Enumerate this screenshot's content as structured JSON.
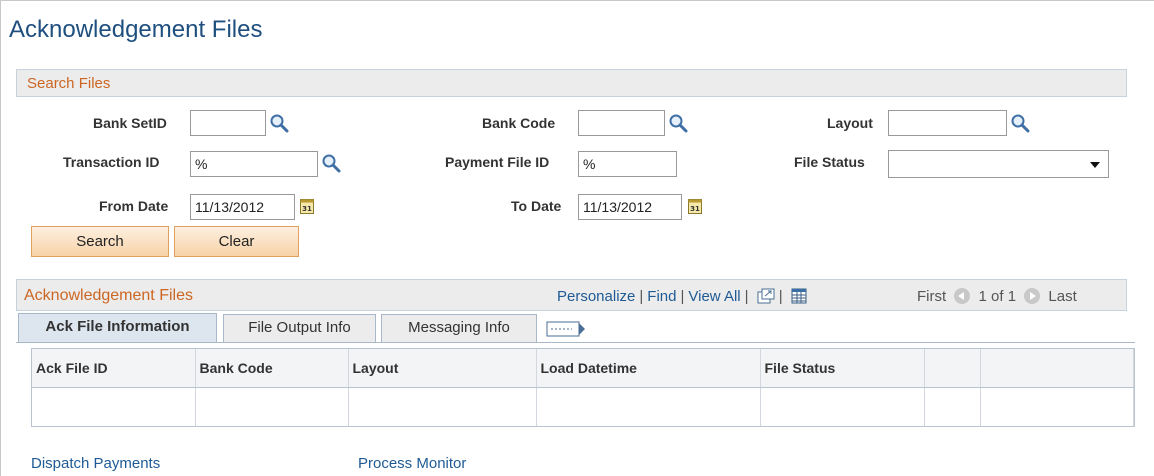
{
  "page": {
    "title": "Acknowledgement Files"
  },
  "search_files": {
    "title": "Search Files",
    "bank_setid": {
      "label": "Bank SetID",
      "value": ""
    },
    "bank_code": {
      "label": "Bank Code",
      "value": ""
    },
    "layout": {
      "label": "Layout",
      "value": ""
    },
    "transaction_id": {
      "label": "Transaction ID",
      "value": "%"
    },
    "payment_file_id": {
      "label": "Payment File ID",
      "value": "%"
    },
    "file_status": {
      "label": "File Status",
      "value": ""
    },
    "from_date": {
      "label": "From Date",
      "value": "11/13/2012"
    },
    "to_date": {
      "label": "To Date",
      "value": "11/13/2012"
    },
    "search_label": "Search",
    "clear_label": "Clear"
  },
  "grid": {
    "title": "Acknowledgement Files",
    "personalize": "Personalize",
    "find": "Find",
    "view_all": "View All",
    "first": "First",
    "range": "1 of 1",
    "last": "Last",
    "tabs": [
      "Ack File Information",
      "File Output Info",
      "Messaging Info"
    ],
    "columns": [
      "Ack File ID",
      "Bank Code",
      "Layout",
      "Load Datetime",
      "File Status",
      "",
      ""
    ]
  },
  "footer": {
    "dispatch_payments": "Dispatch Payments",
    "process_monitor": "Process Monitor"
  },
  "colors": {
    "title": "#1f4f7f",
    "section_title": "#cc6622",
    "link": "#1f5a95",
    "button_bg": "#f8d3a8"
  }
}
